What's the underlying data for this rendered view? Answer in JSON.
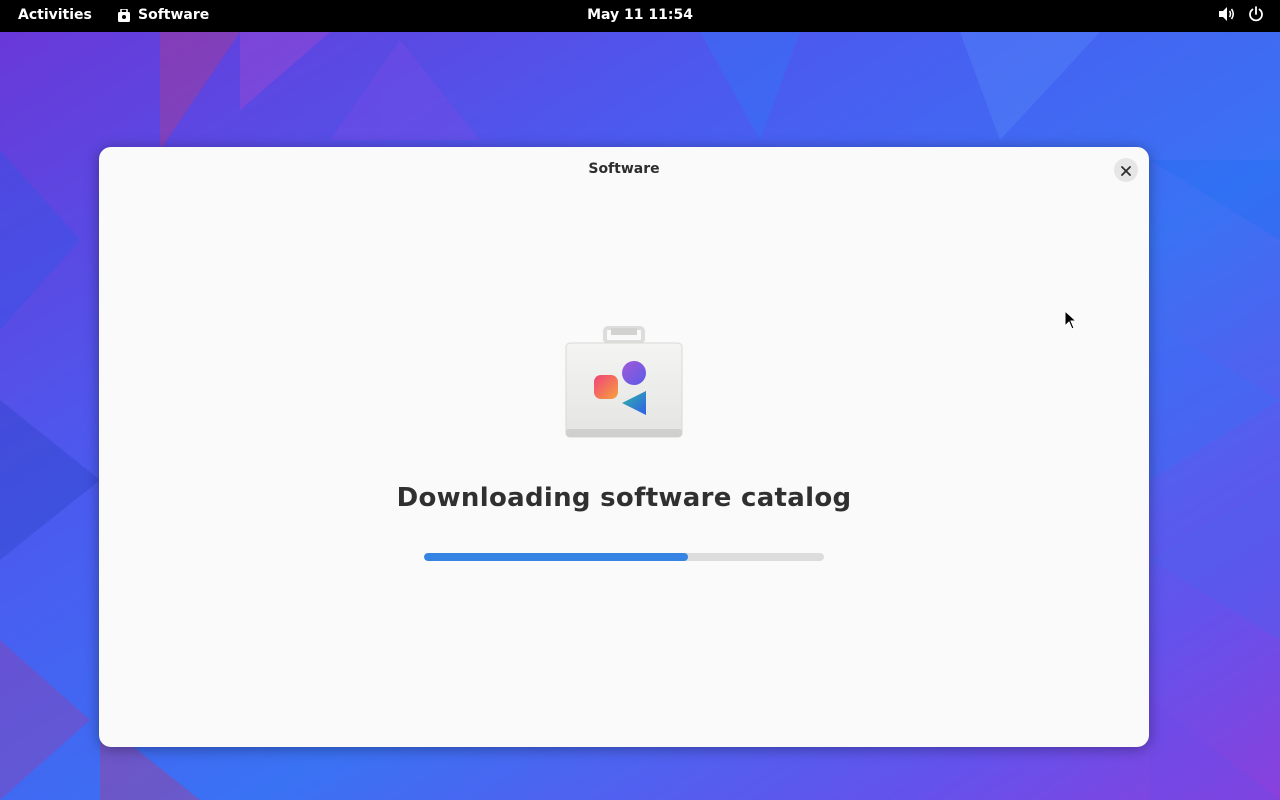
{
  "topbar": {
    "activities_label": "Activities",
    "app_menu_label": "Software",
    "clock": "May 11  11:54",
    "status_icons": [
      "volume-icon",
      "power-icon"
    ]
  },
  "window": {
    "title": "Software",
    "close_icon": "close-icon",
    "hero_icon": "software-bag-icon",
    "heading": "Downloading software catalog",
    "progress_fraction": 0.66
  },
  "colors": {
    "accent": "#3584e4",
    "topbar_bg": "#000000",
    "window_bg": "#fafafa"
  }
}
